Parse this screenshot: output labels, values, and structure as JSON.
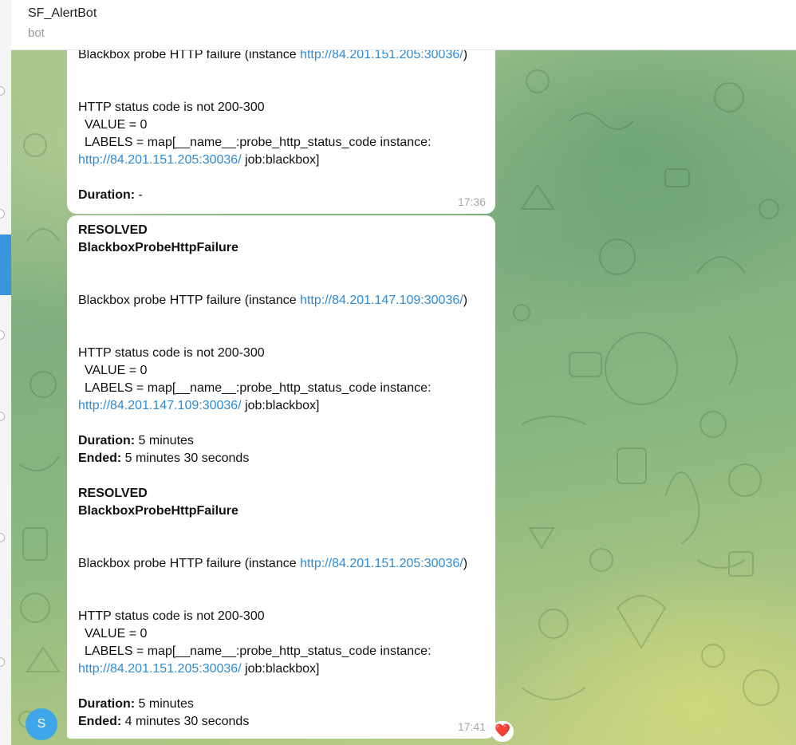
{
  "header": {
    "title": "SF_AlertBot",
    "subtitle": "bot"
  },
  "avatar": {
    "initial": "S"
  },
  "reaction": {
    "emoji": "❤️"
  },
  "messages": [
    {
      "time": "17:36",
      "probe_text": "Blackbox probe HTTP failure (instance ",
      "instance_link": "http://84.201.151.205:30036/",
      "probe_close": ")",
      "status_text": "HTTP status code is not 200-300",
      "value_text": "VALUE = 0",
      "labels_text": "LABELS = map[__name__:probe_http_status_code instance:",
      "labels_link": "http://84.201.151.205:30036/",
      "labels_job": " job:blackbox]",
      "duration_label": "Duration:",
      "duration_value": " -"
    },
    {
      "time": "17:41",
      "alerts": [
        {
          "status": "RESOLVED",
          "name": "BlackboxProbeHttpFailure",
          "probe_text": "Blackbox probe HTTP failure (instance ",
          "instance_link": "http://84.201.147.109:30036/",
          "probe_close": ")",
          "status_text": "HTTP status code is not 200-300",
          "value_text": "VALUE = 0",
          "labels_text": "LABELS = map[__name__:probe_http_status_code instance:",
          "labels_link": "http://84.201.147.109:30036/",
          "labels_job": " job:blackbox]",
          "duration_label": "Duration:",
          "duration_value": " 5 minutes",
          "ended_label": "Ended:",
          "ended_value": " 5 minutes 30 seconds"
        },
        {
          "status": "RESOLVED",
          "name": "BlackboxProbeHttpFailure",
          "probe_text": "Blackbox probe HTTP failure (instance ",
          "instance_link": "http://84.201.151.205:30036/",
          "probe_close": ")",
          "status_text": "HTTP status code is not 200-300",
          "value_text": "VALUE = 0",
          "labels_text": "LABELS = map[__name__:probe_http_status_code instance:",
          "labels_link": "http://84.201.151.205:30036/",
          "labels_job": " job:blackbox]",
          "duration_label": "Duration:",
          "duration_value": " 5 minutes",
          "ended_label": "Ended:",
          "ended_value": " 4 minutes 30 seconds"
        }
      ]
    }
  ],
  "colors": {
    "link": "#2f8bd4",
    "accent": "#3a95dd",
    "heart": "#e8202a"
  }
}
